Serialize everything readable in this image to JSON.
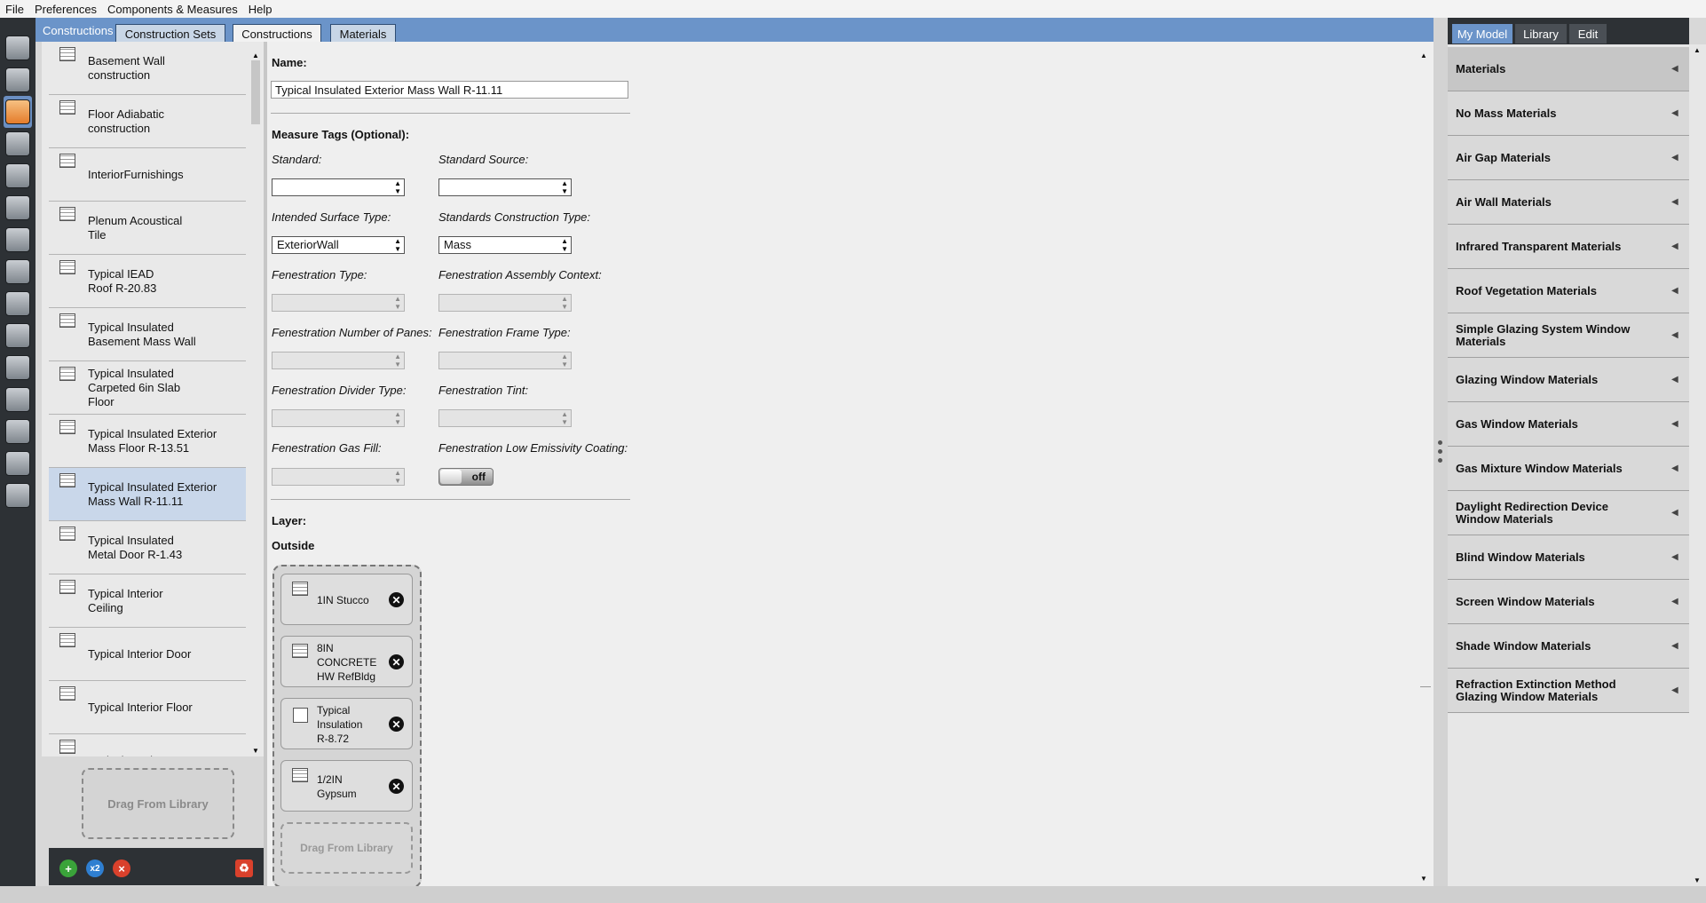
{
  "menu": [
    "File",
    "Preferences",
    "Components & Measures",
    "Help"
  ],
  "tabs": {
    "ghost": "Constructions",
    "items": [
      "Construction Sets",
      "Constructions",
      "Materials"
    ]
  },
  "constructions": [
    "Basement Wall\nconstruction",
    "Floor Adiabatic\nconstruction",
    "InteriorFurnishings",
    "Plenum Acoustical\nTile",
    "Typical IEAD\nRoof R-20.83",
    "Typical Insulated\nBasement Mass Wall",
    "Typical Insulated\nCarpeted 6in Slab\nFloor",
    "Typical Insulated Exterior\nMass Floor R-13.51",
    "Typical Insulated Exterior\nMass Wall R-11.11",
    "Typical Insulated\nMetal Door R-1.43",
    "Typical Interior\nCeiling",
    "Typical Interior Door",
    "Typical Interior Floor",
    "Typical Interior"
  ],
  "selected_index": 8,
  "drag_label": "Drag From Library",
  "form": {
    "name_label": "Name:",
    "name_value": "Typical Insulated Exterior Mass Wall R-11.11",
    "measure_tags_label": "Measure Tags (Optional):",
    "standard_label": "Standard:",
    "standard_value": "",
    "standard_source_label": "Standard Source:",
    "standard_source_value": "",
    "intended_surface_label": "Intended Surface Type:",
    "intended_surface_value": "ExteriorWall",
    "standards_construction_label": "Standards Construction Type:",
    "standards_construction_value": "Mass",
    "fenestration_type_label": "Fenestration Type:",
    "fenestration_assembly_label": "Fenestration Assembly Context:",
    "fenestration_panes_label": "Fenestration Number of Panes:",
    "fenestration_frame_label": "Fenestration Frame Type:",
    "fenestration_divider_label": "Fenestration Divider Type:",
    "fenestration_tint_label": "Fenestration Tint:",
    "fenestration_gas_label": "Fenestration Gas Fill:",
    "fenestration_lowe_label": "Fenestration Low Emissivity Coating:",
    "lowe_toggle": "off",
    "layer_label": "Layer:",
    "outside_label": "Outside"
  },
  "layers": [
    {
      "label": "1IN Stucco",
      "icon": "grid-material-icon"
    },
    {
      "label": "8IN\nCONCRETE\nHW RefBldg",
      "icon": "grid-material-icon"
    },
    {
      "label": "Typical\nInsulation\nR-8.72",
      "icon": "nomass-material-icon"
    },
    {
      "label": "1/2IN\nGypsum",
      "icon": "grid-material-icon"
    }
  ],
  "right_tabs": [
    "My Model",
    "Library",
    "Edit"
  ],
  "right_items": [
    "Materials",
    "No Mass Materials",
    "Air Gap Materials",
    "Air Wall Materials",
    "Infrared Transparent Materials",
    "Roof Vegetation Materials",
    "Simple Glazing System Window Materials",
    "Glazing Window Materials",
    "Gas Window Materials",
    "Gas Mixture Window Materials",
    "Daylight Redirection Device Window Materials",
    "Blind Window Materials",
    "Screen Window Materials",
    "Shade Window Materials",
    "Refraction Extinction Method Glazing Window Materials"
  ],
  "colors": {
    "accent": "#6b94c9",
    "dark": "#2d3135",
    "selected": "#c9d7ea"
  }
}
